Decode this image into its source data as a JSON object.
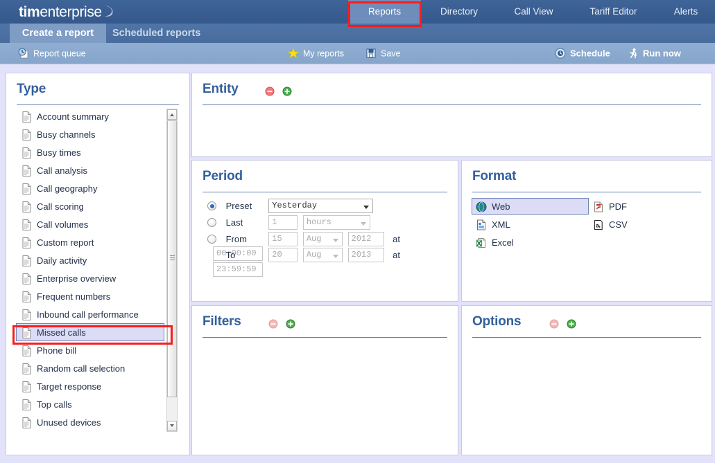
{
  "app": {
    "logo_bold": "tim",
    "logo_rest": "enterprise"
  },
  "nav": {
    "items": [
      {
        "label": "Reports",
        "active": true
      },
      {
        "label": "Directory",
        "active": false
      },
      {
        "label": "Call View",
        "active": false
      },
      {
        "label": "Tariff Editor",
        "active": false
      },
      {
        "label": "Alerts",
        "active": false
      }
    ]
  },
  "tabs": {
    "items": [
      {
        "label": "Create a report",
        "active": true
      },
      {
        "label": "Scheduled reports",
        "active": false
      }
    ]
  },
  "toolbar": {
    "report_queue": "Report queue",
    "my_reports": "My reports",
    "save": "Save",
    "schedule": "Schedule",
    "run_now": "Run now",
    "icons": {
      "report_queue": "report-queue-icon",
      "my_reports": "star-icon",
      "save": "floppy-disk-icon",
      "schedule": "clock-icon",
      "run_now": "running-man-icon"
    }
  },
  "type_panel": {
    "title": "Type",
    "items": [
      {
        "label": "Account summary",
        "selected": false
      },
      {
        "label": "Busy channels",
        "selected": false
      },
      {
        "label": "Busy times",
        "selected": false
      },
      {
        "label": "Call analysis",
        "selected": false
      },
      {
        "label": "Call geography",
        "selected": false
      },
      {
        "label": "Call scoring",
        "selected": false
      },
      {
        "label": "Call volumes",
        "selected": false
      },
      {
        "label": "Custom report",
        "selected": false
      },
      {
        "label": "Daily activity",
        "selected": false
      },
      {
        "label": "Enterprise overview",
        "selected": false
      },
      {
        "label": "Frequent numbers",
        "selected": false
      },
      {
        "label": "Inbound call performance",
        "selected": false
      },
      {
        "label": "Missed calls",
        "selected": true
      },
      {
        "label": "Phone bill",
        "selected": false
      },
      {
        "label": "Random call selection",
        "selected": false
      },
      {
        "label": "Target response",
        "selected": false
      },
      {
        "label": "Top calls",
        "selected": false
      },
      {
        "label": "Unused devices",
        "selected": false
      }
    ]
  },
  "entity_panel": {
    "title": "Entity",
    "remove_icon": "minus-circle-icon",
    "add_icon": "plus-circle-icon"
  },
  "period_panel": {
    "title": "Period",
    "preset_label": "Preset",
    "preset_value": "Yesterday",
    "last_label": "Last",
    "last_value": "1",
    "last_unit": "hours",
    "from_label": "From",
    "from_day": "15",
    "from_month": "Aug",
    "from_year": "2012",
    "from_at": "at",
    "from_time": "00:00:00",
    "to_label": "To",
    "to_day": "20",
    "to_month": "Aug",
    "to_year": "2013",
    "to_at": "at",
    "to_time": "23:59:59",
    "selected_mode": "Preset"
  },
  "format_panel": {
    "title": "Format",
    "options": [
      {
        "label": "Web",
        "icon": "globe-icon",
        "selected": true
      },
      {
        "label": "PDF",
        "icon": "pdf-icon",
        "selected": false
      },
      {
        "label": "XML",
        "icon": "xml-icon",
        "selected": false
      },
      {
        "label": "CSV",
        "icon": "csv-icon",
        "selected": false
      },
      {
        "label": "Excel",
        "icon": "excel-icon",
        "selected": false
      }
    ]
  },
  "filters_panel": {
    "title": "Filters",
    "remove_icon": "minus-circle-icon",
    "add_icon": "plus-circle-icon"
  },
  "options_panel": {
    "title": "Options",
    "remove_icon": "minus-circle-icon",
    "add_icon": "plus-circle-icon"
  },
  "colors": {
    "header_blue": "#3a5e92",
    "accent_blue": "#34609c",
    "page_bg": "#e2e2fa",
    "annotation_red": "#f91c1c",
    "selection_bg": "#dcdcf6"
  }
}
